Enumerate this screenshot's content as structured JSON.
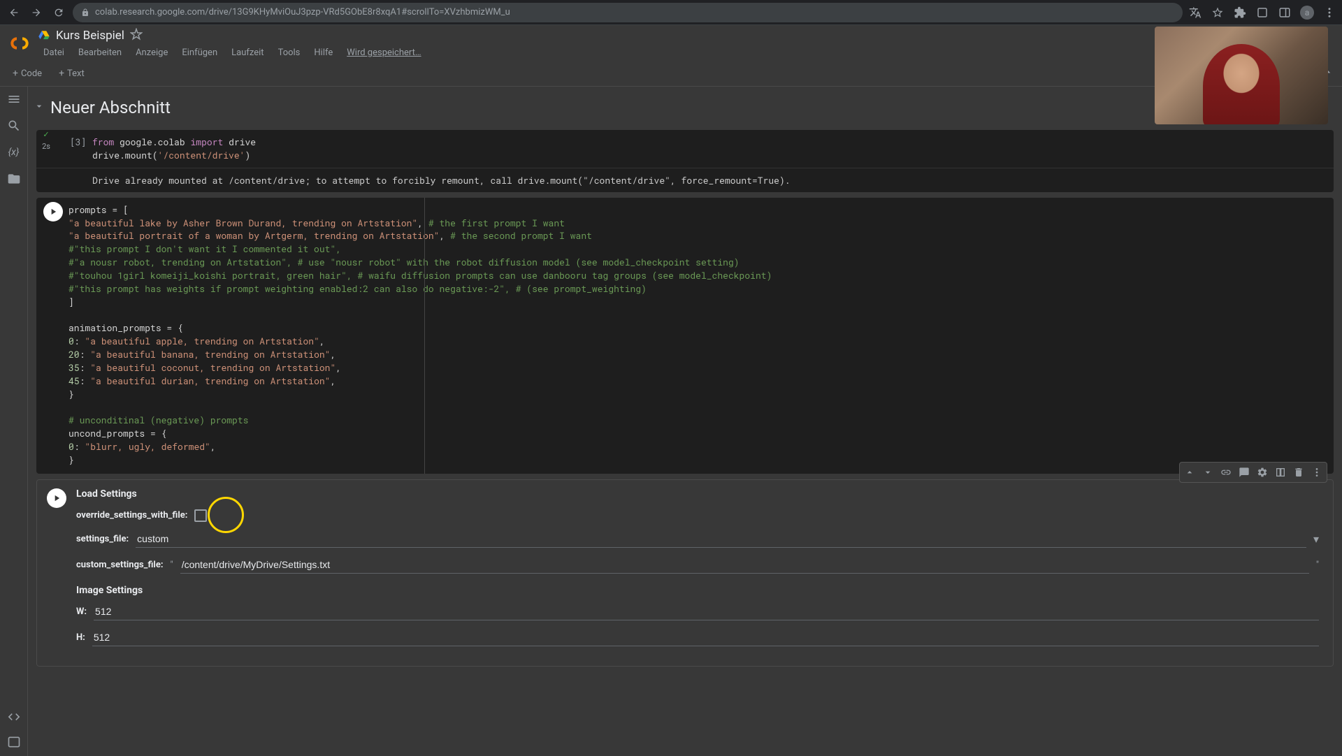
{
  "browser": {
    "url": "colab.research.google.com/drive/13G9KHyMviOuJ3pzp-VRd5GObE8r8xqA1#scrollTo=XVzhbmizWM_u"
  },
  "doc": {
    "title": "Kurs Beispiel",
    "save_status": "Wird gespeichert…"
  },
  "menus": {
    "file": "Datei",
    "edit": "Bearbeiten",
    "view": "Anzeige",
    "insert": "Einfügen",
    "runtime": "Laufzeit",
    "tools": "Tools",
    "help": "Hilfe"
  },
  "toolbar": {
    "code": "Code",
    "text": "Text"
  },
  "section": {
    "title": "Neuer Abschnitt"
  },
  "cell1": {
    "exec_count": "[3]",
    "exec_time": "2s",
    "line1_a": "from",
    "line1_b": "google.colab",
    "line1_c": "import",
    "line1_d": "drive",
    "line2_a": "drive.mount(",
    "line2_b": "'/content/drive'",
    "line2_c": ")",
    "output": "Drive already mounted at /content/drive; to attempt to forcibly remount, call drive.mount(\"/content/drive\", force_remount=True)."
  },
  "cell2": {
    "l1": "prompts = [",
    "l2a": "    \"a beautiful lake by Asher Brown Durand, trending on Artstation\"",
    "l2b": ", ",
    "l2c": "# the first prompt I want",
    "l3a": "    \"a beautiful portrait of a woman by Artgerm, trending on Artstation\"",
    "l3b": ", ",
    "l3c": "# the second prompt I want",
    "l4": "    #\"this prompt I don't want it I commented it out\",",
    "l5": "    #\"a nousr robot, trending on Artstation\", # use \"nousr robot\" with the robot diffusion model (see model_checkpoint setting)",
    "l6": "    #\"touhou 1girl komeiji_koishi portrait, green hair\", # waifu diffusion prompts can use danbooru tag groups (see model_checkpoint)",
    "l7": "    #\"this prompt has weights if prompt weighting enabled:2 can also do negative:-2\", # (see prompt_weighting)",
    "l8": "]",
    "l9": "",
    "l10": "animation_prompts = {",
    "l11a": "    0",
    "l11b": ": ",
    "l11c": "\"a beautiful apple, trending on Artstation\"",
    "l11d": ",",
    "l12a": "    20",
    "l12b": ": ",
    "l12c": "\"a beautiful banana, trending on Artstation\"",
    "l12d": ",",
    "l13a": "    35",
    "l13b": ": ",
    "l13c": "\"a beautiful coconut, trending on Artstation\"",
    "l13d": ",",
    "l14a": "    45",
    "l14b": ": ",
    "l14c": "\"a beautiful durian, trending on Artstation\"",
    "l14d": ",",
    "l15": "}",
    "l16": "",
    "l17": "# unconditinal (negative) prompts",
    "l18": "uncond_prompts = {",
    "l19a": "    0",
    "l19b": ": ",
    "l19c": "\"blurr, ugly, deformed\"",
    "l19d": ",",
    "l20": "}"
  },
  "form": {
    "title": "Load Settings",
    "override_label": "override_settings_with_file:",
    "settings_file_label": "settings_file:",
    "settings_file_value": "custom",
    "custom_settings_label": "custom_settings_file:",
    "custom_settings_value": "/content/drive/MyDrive/Settings.txt",
    "image_title": "Image Settings",
    "w_label": "W:",
    "w_value": "512",
    "h_label": "H:",
    "h_value": "512"
  }
}
